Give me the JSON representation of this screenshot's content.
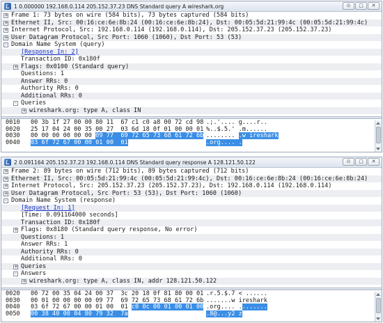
{
  "windows": [
    {
      "title": "1 0.000000 192.168.0.114 205.152.37.23 DNS Standard query A wireshark.org",
      "controls": [
        "⊙",
        "□",
        "✕"
      ],
      "tree": [
        {
          "text": "Frame 1: 73 bytes on wire (584 bits), 73 bytes captured (584 bits)",
          "level": 0,
          "exp": "+"
        },
        {
          "text": "Ethernet II, Src: 00:16:ce:6e:8b:24 (00:16:ce:6e:8b:24), Dst: 00:05:5d:21:99:4c (00:05:5d:21:99:4c)",
          "level": 0,
          "exp": "+"
        },
        {
          "text": "Internet Protocol, Src: 192.168.0.114 (192.168.0.114), Dst: 205.152.37.23 (205.152.37.23)",
          "level": 0,
          "exp": "+"
        },
        {
          "text": "User Datagram Protocol, Src Port: 1060 (1060), Dst Port: 53 (53)",
          "level": 0,
          "exp": "+"
        },
        {
          "text": "Domain Name System (query)",
          "level": 0,
          "exp": "-"
        },
        {
          "text": "[Response In: 2]",
          "level": 1,
          "exp": "",
          "link": true
        },
        {
          "text": "Transaction ID: 0x180f",
          "level": 1,
          "exp": ""
        },
        {
          "text": "Flags: 0x0100 (Standard query)",
          "level": 1,
          "exp": "+"
        },
        {
          "text": "Questions: 1",
          "level": 1,
          "exp": ""
        },
        {
          "text": "Answer RRs: 0",
          "level": 1,
          "exp": ""
        },
        {
          "text": "Authority RRs: 0",
          "level": 1,
          "exp": ""
        },
        {
          "text": "Additional RRs: 0",
          "level": 1,
          "exp": ""
        },
        {
          "text": "Queries",
          "level": 1,
          "exp": "-"
        },
        {
          "text": "wireshark.org: type A, class IN",
          "level": 2,
          "exp": "+"
        }
      ],
      "hex": [
        {
          "off": "0010",
          "bytes": "00 3b 1f 27 00 00 80 11  67 c1 c0 a8 00 72 cd 98",
          "ascii": ".;.'.... g....r..",
          "sel_bytes": "",
          "sel_ascii": ""
        },
        {
          "off": "0020",
          "bytes": "25 17 04 24 00 35 00 27  03 6d 18 0f 01 00 00 01",
          "ascii": "%..$.5.' .m......",
          "sel_bytes": "",
          "sel_ascii": ""
        },
        {
          "off": "0030",
          "bytes": "00 00 00 00 00 00 ",
          "ascii": "........ ",
          "sel_bytes": "09 77  69 72 65 73 68 61 72 6b",
          "sel_ascii": ".w ireshark"
        },
        {
          "off": "0040",
          "bytes": "",
          "ascii": "",
          "sel_bytes": "03 6f 72 67 00 00 01 00  01",
          "sel_ascii": ".org.... ."
        }
      ]
    },
    {
      "title": "2 0.091164 205.152.37.23 192.168.0.114 DNS Standard query response A 128.121.50.122",
      "controls": [
        "⊙",
        "□",
        "✕"
      ],
      "tree": [
        {
          "text": "Frame 2: 89 bytes on wire (712 bits), 89 bytes captured (712 bits)",
          "level": 0,
          "exp": "+"
        },
        {
          "text": "Ethernet II, Src: 00:05:5d:21:99:4c (00:05:5d:21:99:4c), Dst: 00:16:ce:6e:8b:24 (00:16:ce:6e:8b:24)",
          "level": 0,
          "exp": "+"
        },
        {
          "text": "Internet Protocol, Src: 205.152.37.23 (205.152.37.23), Dst: 192.168.0.114 (192.168.0.114)",
          "level": 0,
          "exp": "+"
        },
        {
          "text": "User Datagram Protocol, Src Port: 53 (53), Dst Port: 1060 (1060)",
          "level": 0,
          "exp": "+"
        },
        {
          "text": "Domain Name System (response)",
          "level": 0,
          "exp": "-"
        },
        {
          "text": "[Request In: 1]",
          "level": 1,
          "exp": "",
          "link": true
        },
        {
          "text": "[Time: 0.091164000 seconds]",
          "level": 1,
          "exp": ""
        },
        {
          "text": "Transaction ID: 0x180f",
          "level": 1,
          "exp": ""
        },
        {
          "text": "Flags: 0x8180 (Standard query response, No error)",
          "level": 1,
          "exp": "+"
        },
        {
          "text": "Questions: 1",
          "level": 1,
          "exp": ""
        },
        {
          "text": "Answer RRs: 1",
          "level": 1,
          "exp": ""
        },
        {
          "text": "Authority RRs: 0",
          "level": 1,
          "exp": ""
        },
        {
          "text": "Additional RRs: 0",
          "level": 1,
          "exp": ""
        },
        {
          "text": "Queries",
          "level": 1,
          "exp": "+"
        },
        {
          "text": "Answers",
          "level": 1,
          "exp": "-"
        },
        {
          "text": "wireshark.org: type A, class IN, addr 128.121.50.122",
          "level": 2,
          "exp": "+"
        }
      ],
      "hex": [
        {
          "off": "0020",
          "bytes": "00 72 00 35 04 24 00 37  3c 20 18 0f 81 80 00 01",
          "ascii": ".r.5.$.7 < ......",
          "sel_bytes": "",
          "sel_ascii": ""
        },
        {
          "off": "0030",
          "bytes": "00 01 00 00 00 00 09 77  69 72 65 73 68 61 72 6b",
          "ascii": ".......w ireshark",
          "sel_bytes": "",
          "sel_ascii": ""
        },
        {
          "off": "0040",
          "bytes": "03 6f 72 67 00 00 01 00  01 ",
          "ascii": ".org.... .",
          "sel_bytes": "c0 0c 00 01 00 01 00",
          "sel_ascii": "......."
        },
        {
          "off": "0050",
          "bytes": "",
          "ascii": "",
          "sel_bytes": "00 38 40 00 04 80 79 32  7a",
          "sel_ascii": ".8@...y2 z"
        }
      ]
    }
  ]
}
